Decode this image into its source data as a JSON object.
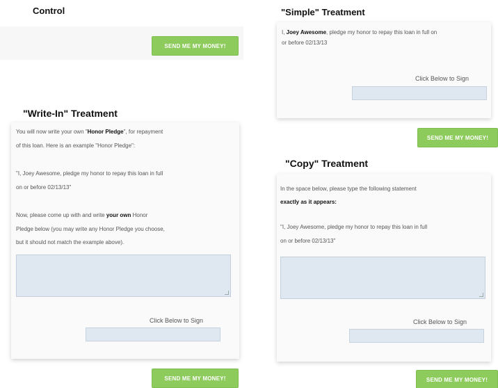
{
  "control": {
    "heading": "Control",
    "send_label": "SEND ME MY MONEY!"
  },
  "simple": {
    "heading": "\"Simple\" Treatment",
    "line1_pre": "I, ",
    "line1_name": "Joey Awesome",
    "line1_post": ", pledge my honor to repay this loan in full on",
    "line2": "or before 02/13/13",
    "sign_label": "Click Below to Sign",
    "send_label": "SEND ME MY MONEY!"
  },
  "writein": {
    "heading": "\"Write-In\" Treatment",
    "l1_pre": "You will now write your own \"",
    "l1_bold": "Honor Pledge",
    "l1_post": "\", for repayment",
    "l2": "of this loan. Here is an example \"Honor Pledge\":",
    "l3": "\"I, Joey Awesome, pledge my honor to repay this loan in full",
    "l4": "on or before 02/13/13\"",
    "l5_pre": "Now, please come up with and write ",
    "l5_bold": "your own",
    "l5_post": " Honor",
    "l6": "Pledge below (you may write any Honor Pledge you choose,",
    "l7": "but it should not match the example above).",
    "sign_label": "Click Below to Sign",
    "send_label": "SEND ME MY MONEY!"
  },
  "copy": {
    "heading": "\"Copy\" Treatment",
    "l1": "In the space below, please type the following statement",
    "l2": "exactly as it appears:",
    "l3": "\"I, Joey Awesome, pledge my honor to repay this loan in full",
    "l4": "on or before 02/13/13\"",
    "sign_label": "Click Below to Sign",
    "send_label": "SEND ME MY MONEY!"
  }
}
